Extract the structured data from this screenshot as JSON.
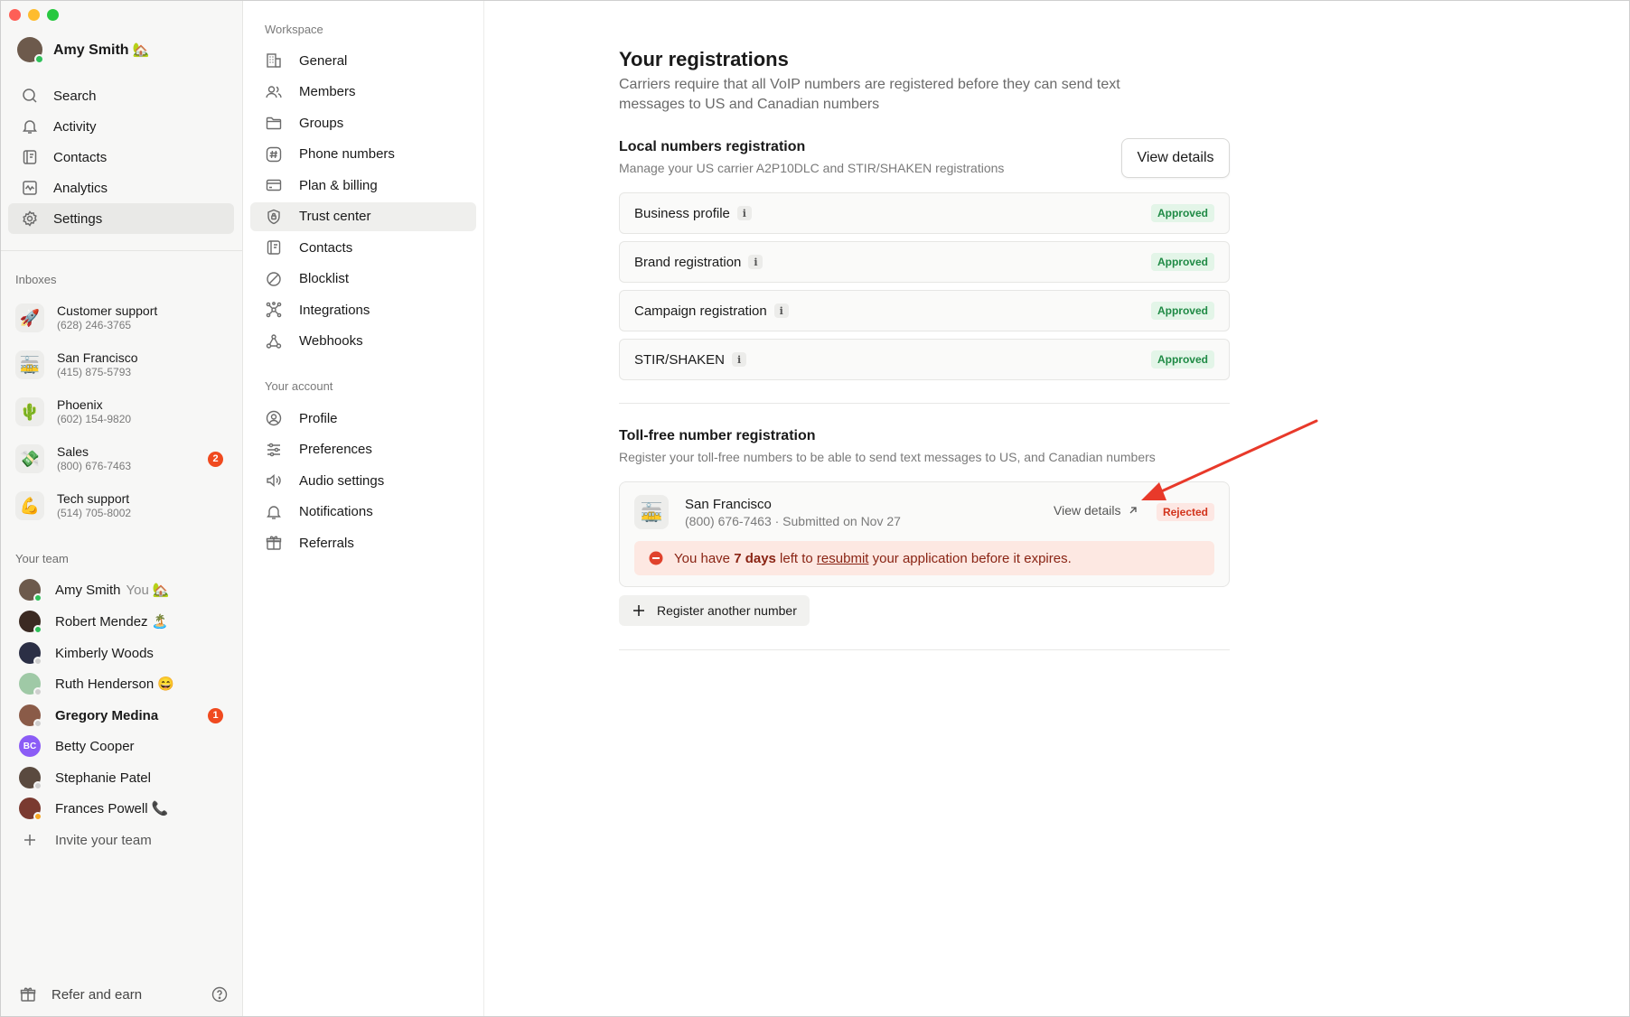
{
  "sidebar": {
    "user": {
      "name": "Amy Smith",
      "emoji": "🏡"
    },
    "nav": [
      "Search",
      "Activity",
      "Contacts",
      "Analytics",
      "Settings"
    ],
    "inboxes_header": "Inboxes",
    "inboxes": [
      {
        "name": "Customer support",
        "phone": "(628) 246-3765",
        "icon": "🚀"
      },
      {
        "name": "San Francisco",
        "phone": "(415) 875-5793",
        "icon": "🚋"
      },
      {
        "name": "Phoenix",
        "phone": "(602) 154-9820",
        "icon": "🌵"
      },
      {
        "name": "Sales",
        "phone": "(800) 676-7463",
        "icon": "💸",
        "badge": "2"
      },
      {
        "name": "Tech support",
        "phone": "(514) 705-8002",
        "icon": "💪"
      }
    ],
    "team_header": "Your team",
    "team": [
      {
        "name": "Amy Smith",
        "you": "You",
        "emoji": "🏡"
      },
      {
        "name": "Robert Mendez",
        "emoji": "🏝️"
      },
      {
        "name": "Kimberly Woods"
      },
      {
        "name": "Ruth Henderson",
        "emoji": "😄"
      },
      {
        "name": "Gregory Medina",
        "badge": "1"
      },
      {
        "name": "Betty Cooper",
        "initials": "BC"
      },
      {
        "name": "Stephanie Patel"
      },
      {
        "name": "Frances Powell",
        "emoji": "📞"
      }
    ],
    "invite": "Invite your team",
    "refer": "Refer and earn"
  },
  "settings": {
    "workspace_header": "Workspace",
    "workspace": [
      "General",
      "Members",
      "Groups",
      "Phone numbers",
      "Plan & billing",
      "Trust center",
      "Contacts",
      "Blocklist",
      "Integrations",
      "Webhooks"
    ],
    "account_header": "Your account",
    "account": [
      "Profile",
      "Preferences",
      "Audio settings",
      "Notifications",
      "Referrals"
    ]
  },
  "main": {
    "title": "Your registrations",
    "subtitle": "Carriers require that all VoIP numbers are registered before they can send text messages to US and Canadian numbers",
    "local": {
      "title": "Local numbers registration",
      "subtitle": "Manage your US carrier A2P10DLC and STIR/SHAKEN registrations",
      "button": "View details",
      "rows": [
        {
          "label": "Business profile",
          "status": "Approved"
        },
        {
          "label": "Brand registration",
          "status": "Approved"
        },
        {
          "label": "Campaign registration",
          "status": "Approved"
        },
        {
          "label": "STIR/SHAKEN",
          "status": "Approved"
        }
      ]
    },
    "tollfree": {
      "title": "Toll-free number registration",
      "subtitle": "Register your toll-free numbers to be able to send text messages to US, and Canadian numbers",
      "item": {
        "name": "San Francisco",
        "details": "(800) 676-7463 · Submitted on Nov 27",
        "view": "View details",
        "status": "Rejected",
        "icon": "🚋"
      },
      "alert": {
        "pre": "You have ",
        "days": "7 days",
        "mid": " left to ",
        "link": "resubmit",
        "post": " your application before it expires."
      },
      "register": "Register another number"
    }
  },
  "colors": {
    "approved": "#1f8a45",
    "rejected": "#d2331b",
    "badge": "#f04a1f",
    "arrow": "#e8392a"
  }
}
